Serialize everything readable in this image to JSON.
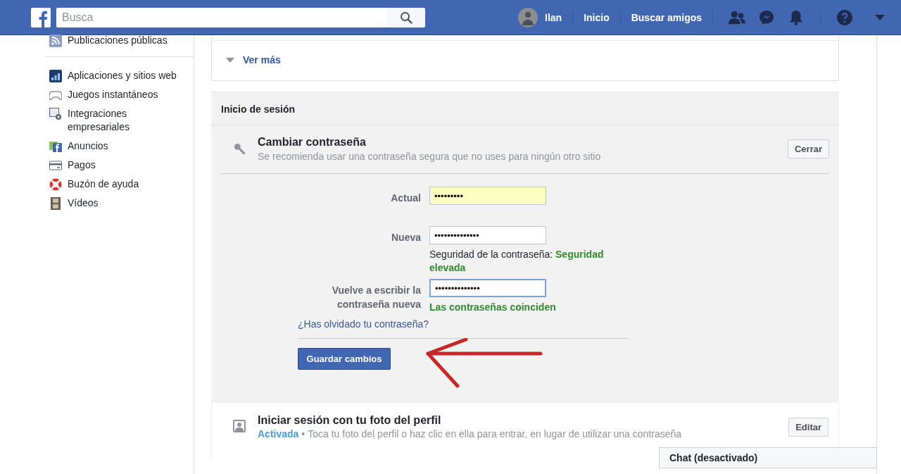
{
  "header": {
    "search": {
      "placeholder": "Busca"
    },
    "user": "Ilan",
    "nav": [
      "Inicio",
      "Buscar amigos"
    ]
  },
  "sidebar": {
    "items": [
      {
        "label": "Publicaciones públicas"
      },
      {
        "label": "Aplicaciones y sitios web"
      },
      {
        "label": "Juegos instantáneos"
      },
      {
        "label": "Integraciones empresariales"
      },
      {
        "label": "Anuncios"
      },
      {
        "label": "Pagos"
      },
      {
        "label": "Buzón de ayuda"
      },
      {
        "label": "Vídeos"
      }
    ]
  },
  "top_card": {
    "link": "Ver más"
  },
  "login_section": {
    "title": "Inicio de sesión",
    "change_password": {
      "title": "Cambiar contraseña",
      "subtitle": "Se recomienda usar una contraseña segura que no uses para ningún otro sitio",
      "close_button": "Cerrar",
      "fields": [
        {
          "label": "Actual",
          "value": "•••••••••",
          "autofilled": true,
          "focused": false
        },
        {
          "label": "Nueva",
          "value": "••••••••••••••",
          "autofilled": false,
          "focused": false,
          "note": "Seguridad de la contraseña: **Seguridad elevada**"
        },
        {
          "label": "Vuelve a escribir la contraseña nueva",
          "value": "••••••••••••••",
          "autofilled": false,
          "focused": true,
          "note": "**Las contraseñas coinciden**"
        }
      ],
      "forgot_link": "¿Has olvidado tu contraseña?",
      "save_button": "Guardar cambios"
    },
    "profile_login": {
      "title": "Iniciar sesión con tu foto del perfil",
      "status": "Activada",
      "separator": "•",
      "description": "Toca tu foto del perfil o haz clic en ella para entrar, en lugar de utilizar una contraseña",
      "edit_button": "Editar"
    }
  },
  "chat": {
    "label": "Chat (desactivado)"
  }
}
